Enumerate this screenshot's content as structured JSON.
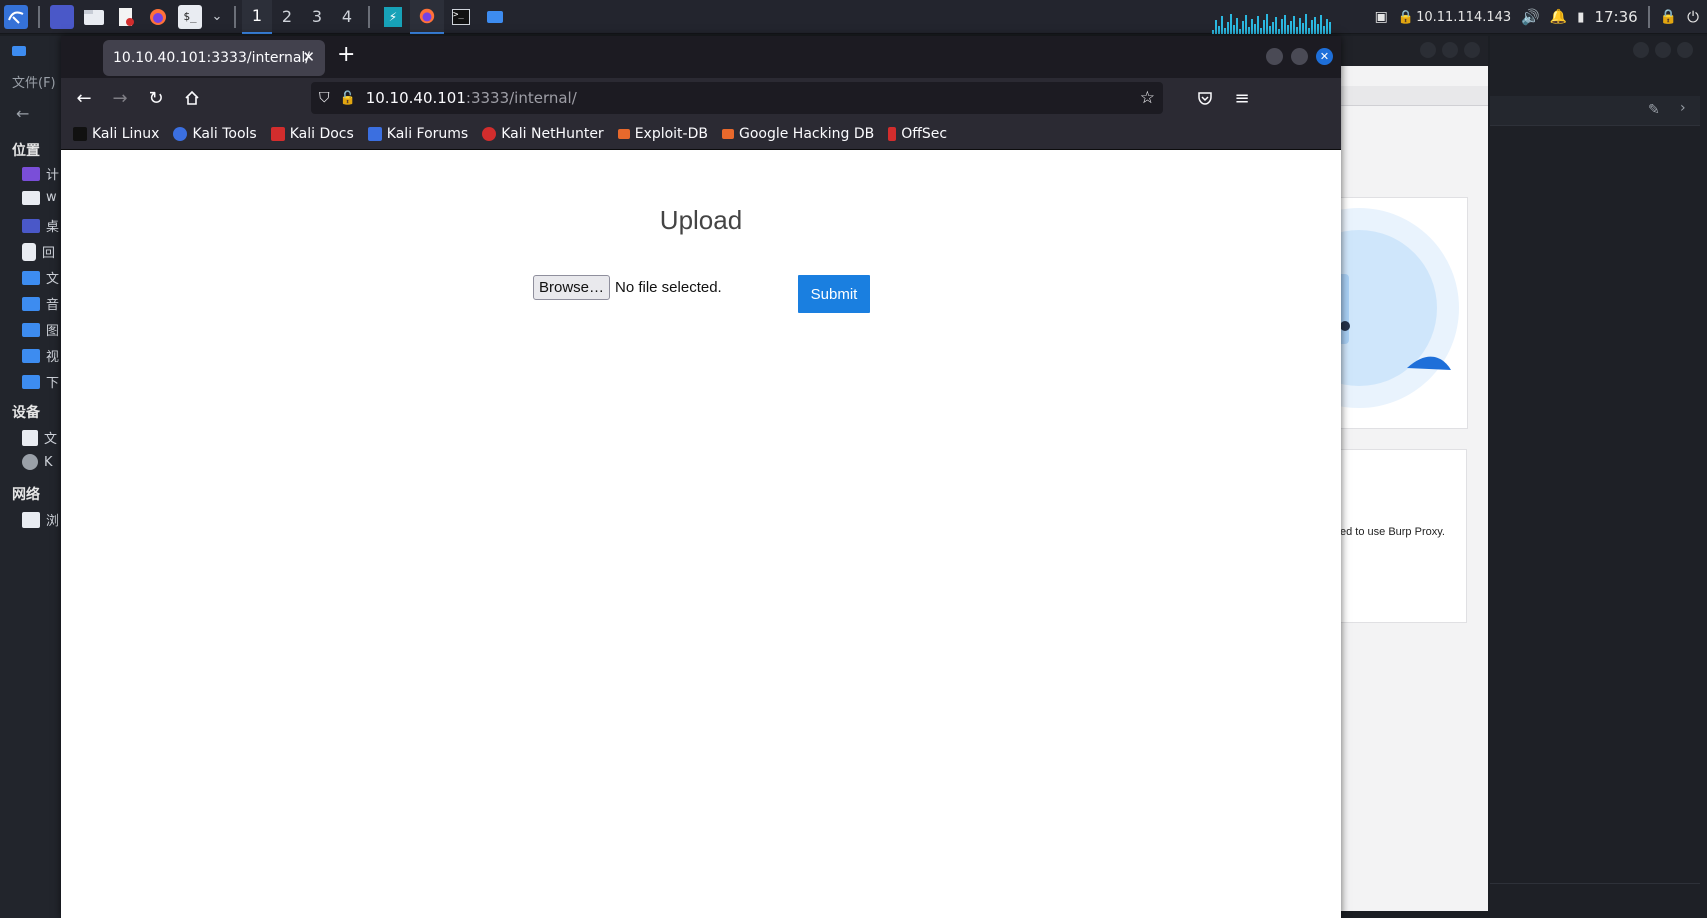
{
  "taskbar": {
    "workspaces": [
      "1",
      "2",
      "3",
      "4"
    ],
    "active_workspace": "1",
    "ip": "10.11.114.143",
    "time": "17:36"
  },
  "file_manager": {
    "menu": "文件(F)",
    "places_heading": "位置",
    "devices_heading": "设备",
    "network_heading": "网络",
    "places": [
      "计",
      "w",
      "桌",
      "回",
      "文",
      "音",
      "图",
      "视",
      "下"
    ],
    "devices": [
      "文",
      "K"
    ],
    "network": [
      "浏"
    ]
  },
  "background_window": {
    "card_text": "ed to use Burp Proxy."
  },
  "firefox": {
    "tab_title": "10.10.40.101:3333/internal/",
    "url_host": "10.10.40.101",
    "url_rest": ":3333/internal/",
    "bookmarks": [
      {
        "label": "Kali Linux",
        "color": "#111111"
      },
      {
        "label": "Kali Tools",
        "color": "#3b6fe0"
      },
      {
        "label": "Kali Docs",
        "color": "#d22d2d"
      },
      {
        "label": "Kali Forums",
        "color": "#3b6fe0"
      },
      {
        "label": "Kali NetHunter",
        "color": "#d22d2d"
      },
      {
        "label": "Exploit-DB",
        "color": "#e8692c"
      },
      {
        "label": "Google Hacking DB",
        "color": "#e8692c"
      },
      {
        "label": "OffSec",
        "color": "#d22d2d"
      }
    ]
  },
  "page": {
    "title": "Upload",
    "browse_label": "Browse…",
    "no_file_text": "No file selected.",
    "submit_label": "Submit"
  },
  "colors": {
    "accent": "#3d8cf0",
    "submit": "#1a7fe0",
    "firefox_chrome": "#2b2a33",
    "close_button": "#1e6fd9"
  }
}
